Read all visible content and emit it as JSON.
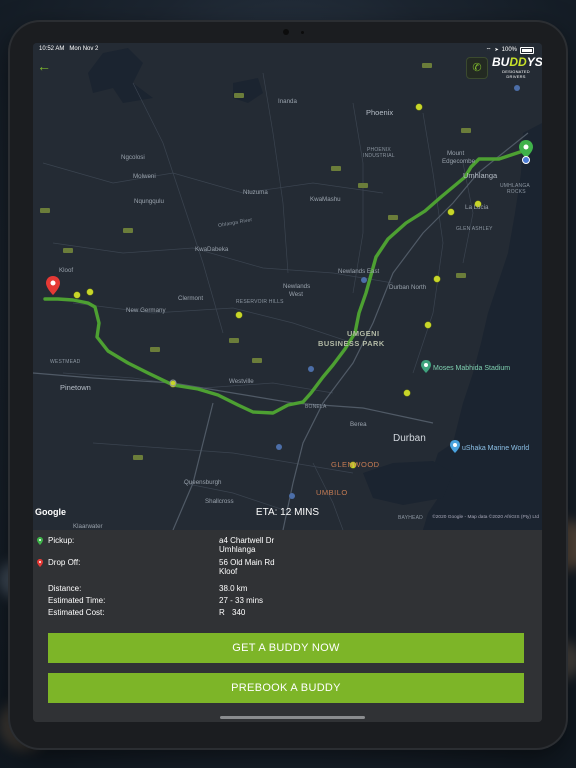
{
  "status_bar": {
    "time": "10:52 AM",
    "date": "Mon Nov 2",
    "battery": "100%"
  },
  "header": {
    "logo_main_pre": "BU",
    "logo_main_mid": "DD",
    "logo_main_post": "YS",
    "logo_sub": "DESIGNATED DRIVERS",
    "icons": {
      "back": "arrow-left-icon",
      "call": "phone-icon"
    }
  },
  "map": {
    "labels": {
      "inanda": "Inanda",
      "phoenix": "Phoenix",
      "phoenix_industrial_1": "PHOENIX",
      "phoenix_industrial_2": "INDUSTRIAL",
      "mount_edgecombe_1": "Mount",
      "mount_edgecombe_2": "Edgecombe",
      "umhlanga": "Umhlanga",
      "umhlanga_rocks_1": "UMHLANGA",
      "umhlanga_rocks_2": "ROCKS",
      "la_lucia": "La Lucia",
      "glen_ashley": "GLEN ASHLEY",
      "ngcolosi": "Ngcolosi",
      "molweni": "Molweni",
      "nqungqulu": "Nqungqulu",
      "ntuzuma": "Ntuzuma",
      "kwamashu": "KwaMashu",
      "kwadabeka": "KwaDabeka",
      "kloof": "Kloof",
      "clermont": "Clermont",
      "reservoir_hills": "RESERVOIR HILLS",
      "newlands_west_1": "Newlands",
      "newlands_west_2": "West",
      "newlands_east": "Newlands East",
      "durban_north": "Durban North",
      "new_germany": "New Germany",
      "umgeni_1": "UMGENI",
      "umgeni_2": "BUSINESS PARK",
      "westmead": "WESTMEAD",
      "pinetown": "Pinetown",
      "westville": "Westville",
      "moses_mabhida": "Moses Mabhida Stadium",
      "bonela": "BONELA",
      "berea": "Berea",
      "durban": "Durban",
      "ushaka": "uShaka Marine World",
      "glenwood": "GLENWOOD",
      "queensburgh": "Queensburgh",
      "umbilo": "UMBILO",
      "shallcross": "Shallcross",
      "klaarwater": "Klaarwater",
      "bayhead": "BAYHEAD",
      "ohlanga_river": "Ohlanga River"
    },
    "google_logo": "Google",
    "eta": "ETA: 12 MINS",
    "copyright": "©2020 Google - Map data ©2020 AfriGIS (Pty) Ltd",
    "colors": {
      "route": "#4da032",
      "pickup_pin": "#3fb24a",
      "dropoff_pin": "#e53935",
      "water": "#1c2734",
      "land": "#252b34"
    }
  },
  "trip": {
    "pickup_label": "Pickup:",
    "pickup_line1": "a4 Chartwell Dr",
    "pickup_line2": "Umhlanga",
    "dropoff_label": "Drop Off:",
    "dropoff_line1": "56 Old Main Rd",
    "dropoff_line2": "Kloof",
    "distance_label": "Distance:",
    "distance_value": "38.0 km",
    "time_label": "Estimated Time:",
    "time_value": "27 - 33 mins",
    "cost_label": "Estimated Cost:",
    "cost_currency": "R",
    "cost_value": "340"
  },
  "actions": {
    "get_buddy": "GET A BUDDY NOW",
    "prebook": "PREBOOK A BUDDY"
  },
  "accent_color": "#7db528"
}
